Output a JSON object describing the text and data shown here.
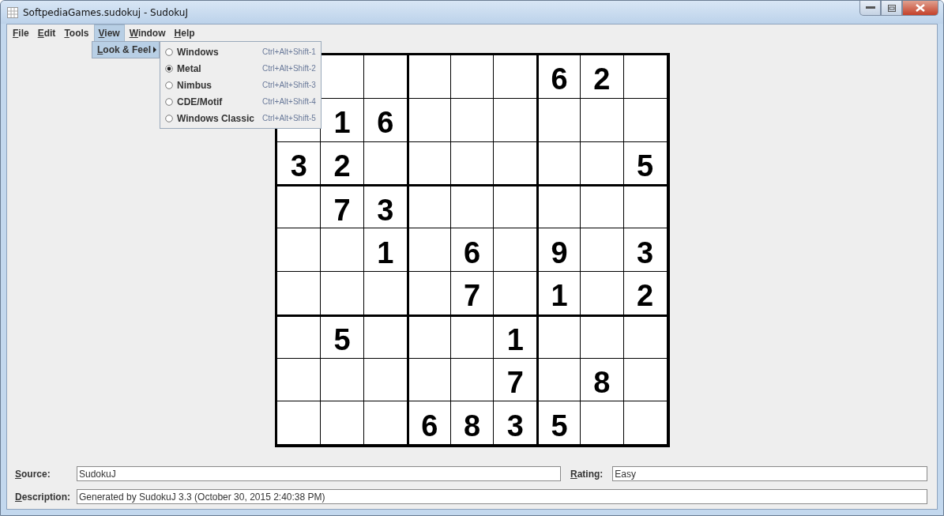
{
  "window": {
    "title": "SoftpediaGames.sudokuj - SudokuJ"
  },
  "menu_bar": [
    {
      "label": "File",
      "selected": false
    },
    {
      "label": "Edit",
      "selected": false
    },
    {
      "label": "Tools",
      "selected": false
    },
    {
      "label": "View",
      "selected": true
    },
    {
      "label": "Window",
      "selected": false
    },
    {
      "label": "Help",
      "selected": false
    }
  ],
  "view_menu": [
    {
      "label": "Look & Feel",
      "selected": true
    }
  ],
  "look_and_feel_menu": [
    {
      "label": "Windows",
      "shortcut": "Ctrl+Alt+Shift-1",
      "selected": false
    },
    {
      "label": "Metal",
      "shortcut": "Ctrl+Alt+Shift-2",
      "selected": true
    },
    {
      "label": "Nimbus",
      "shortcut": "Ctrl+Alt+Shift-3",
      "selected": false
    },
    {
      "label": "CDE/Motif",
      "shortcut": "Ctrl+Alt+Shift-4",
      "selected": false
    },
    {
      "label": "Windows Classic",
      "shortcut": "Ctrl+Alt+Shift-5",
      "selected": false
    }
  ],
  "grid": [
    {
      "cells": [
        {
          "kind": "covered"
        },
        {
          "kind": "empty"
        },
        {
          "kind": "empty"
        },
        {
          "kind": "empty"
        },
        {
          "kind": "empty"
        },
        {
          "kind": "empty"
        },
        {
          "kind": "digit",
          "value": "6"
        },
        {
          "kind": "digit",
          "value": "2"
        },
        {
          "kind": "empty"
        }
      ]
    },
    {
      "cells": [
        {
          "kind": "empty"
        },
        {
          "kind": "digit",
          "value": "1"
        },
        {
          "kind": "digit",
          "value": "6"
        },
        {
          "kind": "empty"
        },
        {
          "kind": "empty"
        },
        {
          "kind": "empty"
        },
        {
          "kind": "empty"
        },
        {
          "kind": "empty"
        },
        {
          "kind": "empty"
        }
      ]
    },
    {
      "cells": [
        {
          "kind": "digit",
          "value": "3"
        },
        {
          "kind": "digit",
          "value": "2"
        },
        {
          "kind": "empty"
        },
        {
          "kind": "empty"
        },
        {
          "kind": "empty"
        },
        {
          "kind": "empty"
        },
        {
          "kind": "empty"
        },
        {
          "kind": "empty"
        },
        {
          "kind": "digit",
          "value": "5"
        }
      ]
    },
    {
      "cells": [
        {
          "kind": "empty"
        },
        {
          "kind": "digit",
          "value": "7"
        },
        {
          "kind": "digit",
          "value": "3"
        },
        {
          "kind": "empty"
        },
        {
          "kind": "empty"
        },
        {
          "kind": "empty"
        },
        {
          "kind": "empty"
        },
        {
          "kind": "empty"
        },
        {
          "kind": "empty"
        }
      ]
    },
    {
      "cells": [
        {
          "kind": "empty"
        },
        {
          "kind": "empty"
        },
        {
          "kind": "digit",
          "value": "1"
        },
        {
          "kind": "empty"
        },
        {
          "kind": "digit",
          "value": "6"
        },
        {
          "kind": "empty"
        },
        {
          "kind": "digit",
          "value": "9"
        },
        {
          "kind": "empty"
        },
        {
          "kind": "digit",
          "value": "3"
        }
      ]
    },
    {
      "cells": [
        {
          "kind": "empty"
        },
        {
          "kind": "empty"
        },
        {
          "kind": "empty"
        },
        {
          "kind": "empty"
        },
        {
          "kind": "digit",
          "value": "7"
        },
        {
          "kind": "empty"
        },
        {
          "kind": "digit",
          "value": "1"
        },
        {
          "kind": "empty"
        },
        {
          "kind": "digit",
          "value": "2"
        }
      ]
    },
    {
      "cells": [
        {
          "kind": "empty"
        },
        {
          "kind": "digit",
          "value": "5"
        },
        {
          "kind": "empty"
        },
        {
          "kind": "empty"
        },
        {
          "kind": "empty"
        },
        {
          "kind": "digit",
          "value": "1"
        },
        {
          "kind": "empty"
        },
        {
          "kind": "empty"
        },
        {
          "kind": "empty"
        }
      ]
    },
    {
      "cells": [
        {
          "kind": "empty"
        },
        {
          "kind": "empty"
        },
        {
          "kind": "empty"
        },
        {
          "kind": "empty"
        },
        {
          "kind": "empty"
        },
        {
          "kind": "digit",
          "value": "7"
        },
        {
          "kind": "empty"
        },
        {
          "kind": "digit",
          "value": "8"
        },
        {
          "kind": "empty"
        }
      ]
    },
    {
      "cells": [
        {
          "kind": "empty"
        },
        {
          "kind": "empty"
        },
        {
          "kind": "empty"
        },
        {
          "kind": "digit",
          "value": "6"
        },
        {
          "kind": "digit",
          "value": "8"
        },
        {
          "kind": "digit",
          "value": "3"
        },
        {
          "kind": "digit",
          "value": "5"
        },
        {
          "kind": "empty"
        },
        {
          "kind": "empty"
        }
      ]
    }
  ],
  "source": {
    "label": "Source:",
    "value": "SudokuJ"
  },
  "rating": {
    "label": "Rating:",
    "value": "Easy"
  },
  "description": {
    "label": "Description:",
    "value": "Generated by SudokuJ 3.3 (October 30, 2015 2:40:38 PM)"
  }
}
